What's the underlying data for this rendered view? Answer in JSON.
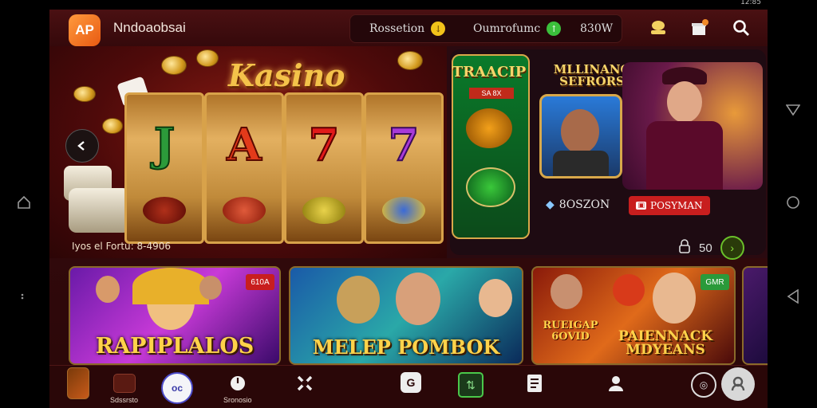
{
  "status_bar": {
    "time": "12:85"
  },
  "header": {
    "logo_text": "AP",
    "brand": "Nndoaobsai",
    "pills": [
      {
        "label": "Rossetion",
        "icon": "coin-down-icon"
      },
      {
        "label": "Oumrofumc",
        "icon": "arrow-up-icon"
      },
      {
        "label": "830W",
        "icon": ""
      }
    ]
  },
  "hero": {
    "title": "Kasino",
    "reels": [
      "J",
      "A",
      "7",
      "7"
    ],
    "caption": "Iyos el Fortu: 8-4906"
  },
  "promo": {
    "left_title": "TRAACIP",
    "left_badge": "SA 8X",
    "right_title": "MLLINANG\nSEFRORS",
    "stat_label": "8OSZON",
    "tag_button": "POSYMAN",
    "count": "50"
  },
  "cards": [
    {
      "label": "RAPIPLALOS",
      "badge": "610A"
    },
    {
      "label": "MELEP POMBOK",
      "badge": ""
    },
    {
      "label": "PAIENNACK\nMDYEANS",
      "badge": "GMR"
    }
  ],
  "card3_sublabel": "RUEIGAP\n6OVID",
  "bottom_nav": [
    {
      "label": "",
      "icon": "game-tile-icon"
    },
    {
      "label": "Sdssrsto",
      "icon": "game-tile-icon"
    },
    {
      "label": "",
      "icon": "chat-icon"
    },
    {
      "label": "Sronosio",
      "icon": "power-icon"
    },
    {
      "label": "",
      "icon": "cross-icon"
    },
    {
      "label": "",
      "icon": "gamepad-icon"
    },
    {
      "label": "",
      "icon": "wallet-icon"
    },
    {
      "label": "",
      "icon": "document-icon"
    },
    {
      "label": "",
      "icon": "profile-icon"
    },
    {
      "label": "",
      "icon": "support-icon"
    },
    {
      "label": "",
      "icon": "user-circle-icon"
    }
  ],
  "colors": {
    "accent_gold": "#f4c34a",
    "background": "#2a0708",
    "danger": "#c81e1e",
    "logo_orange": "#f07a2a"
  }
}
